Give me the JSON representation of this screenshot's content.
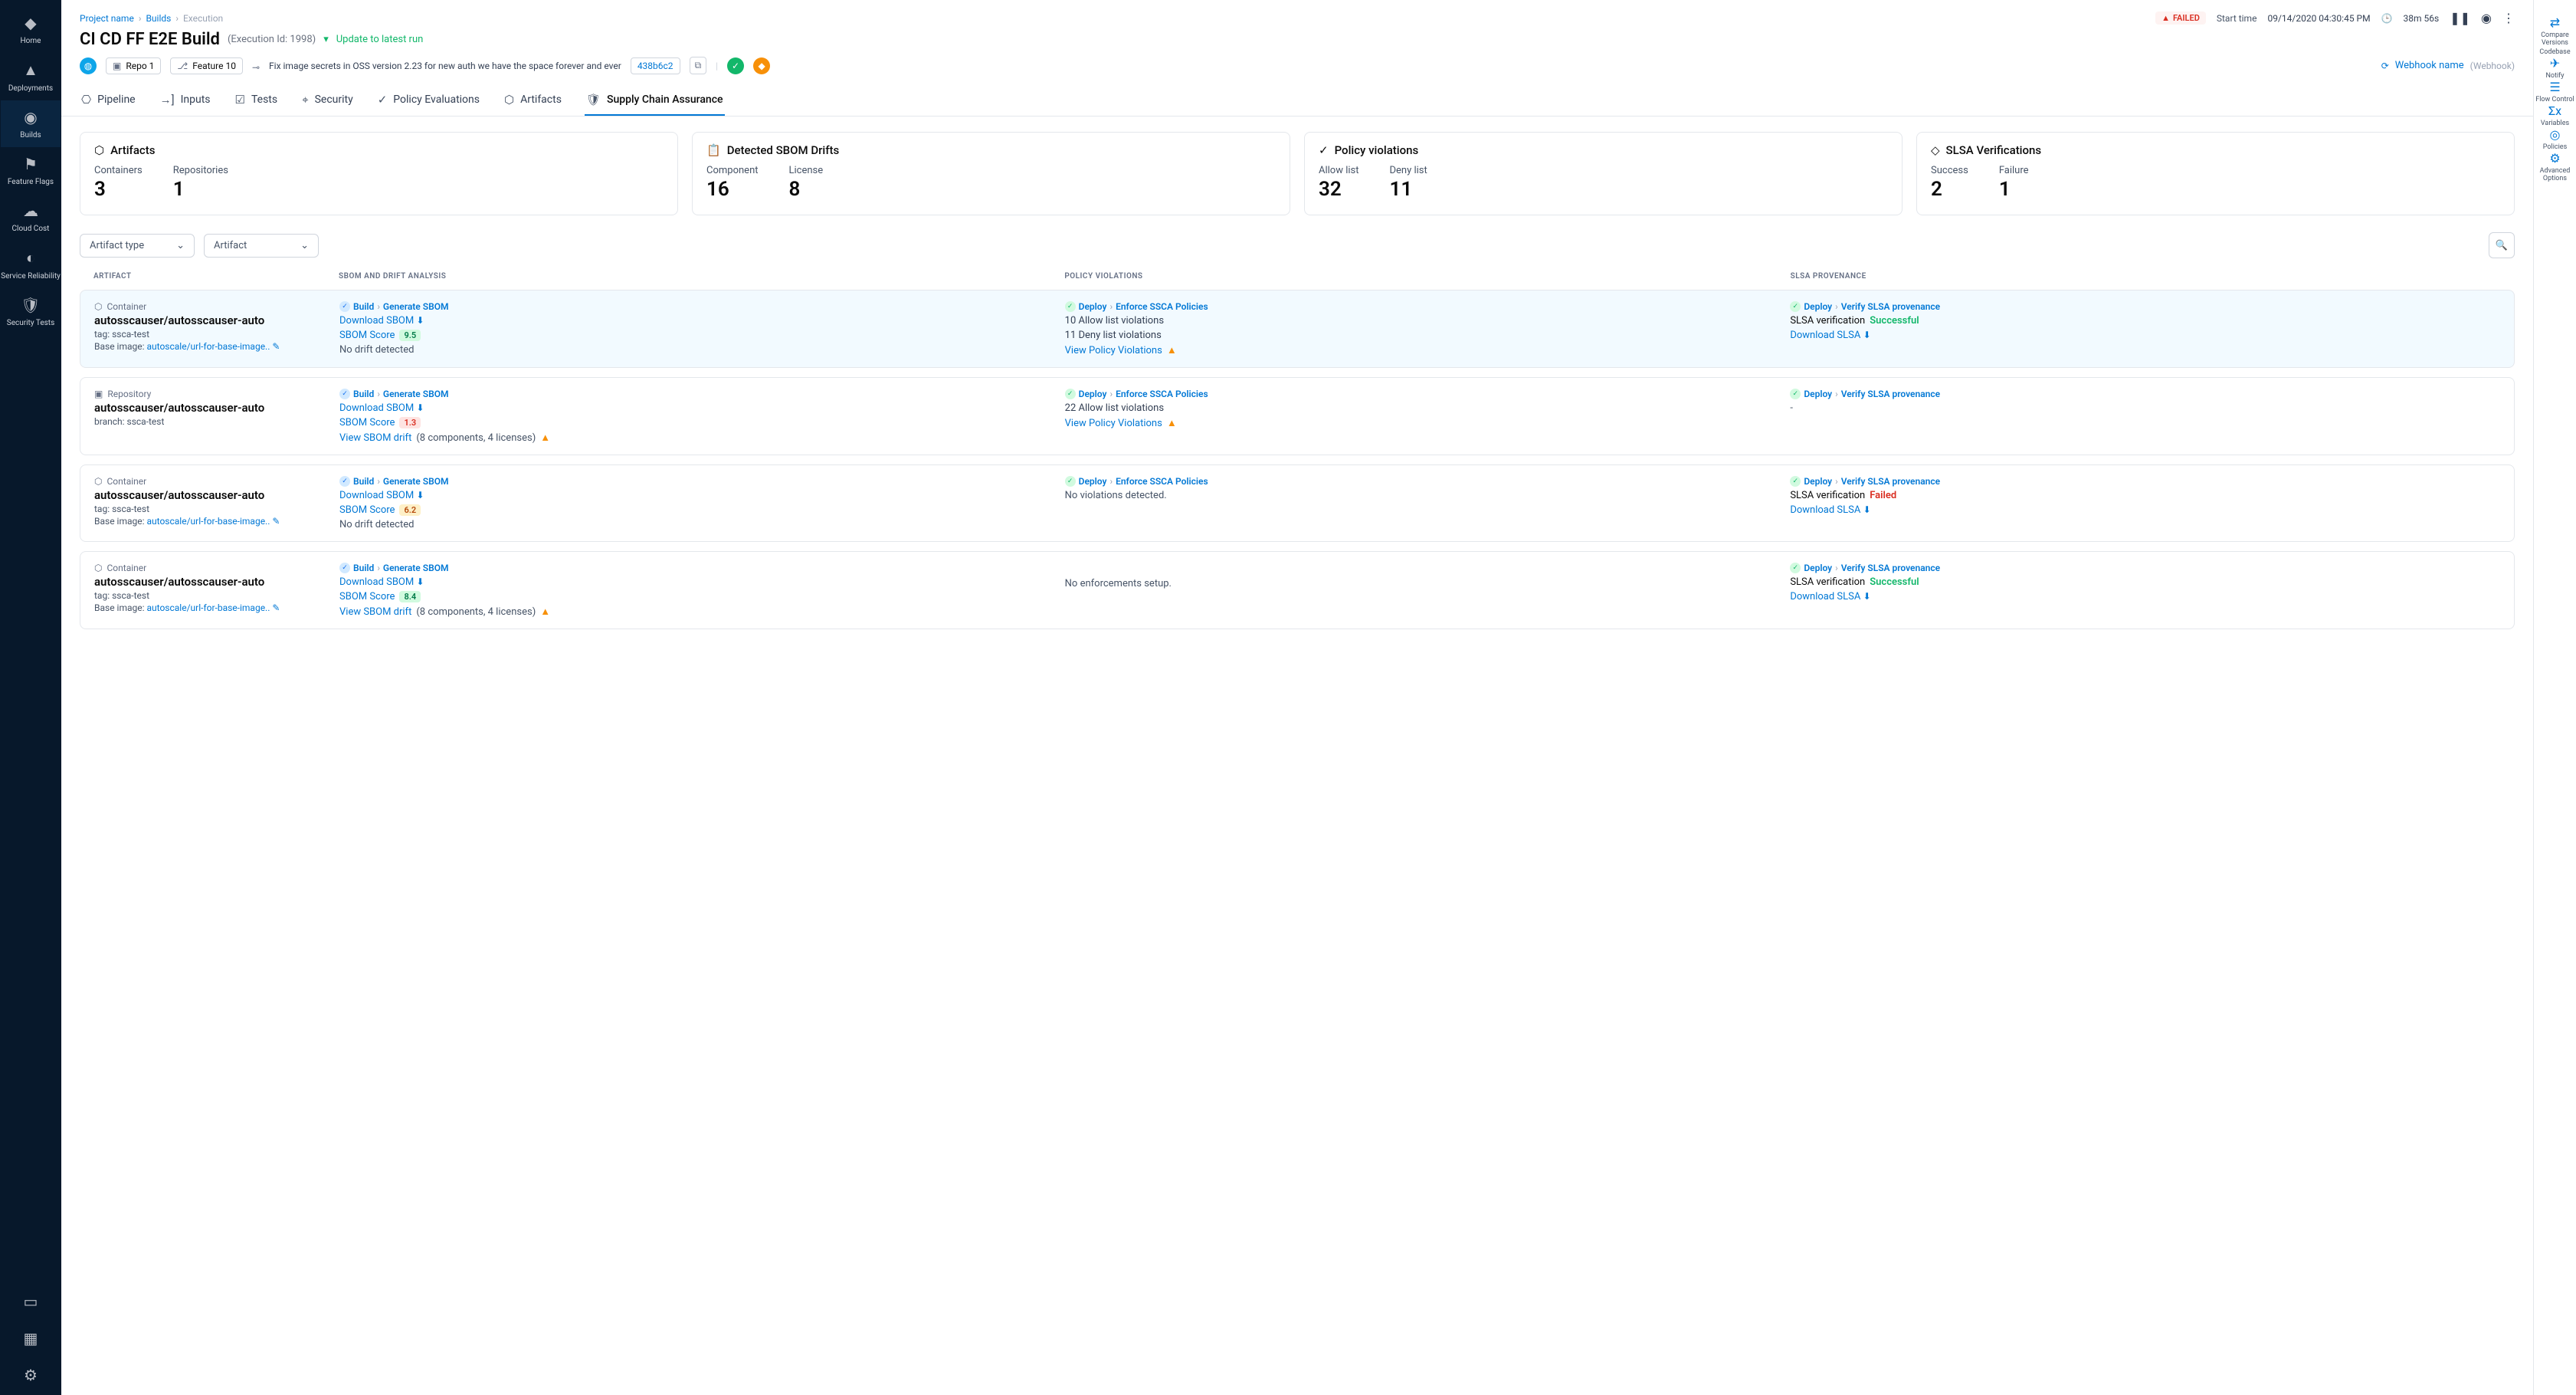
{
  "nav": {
    "items": [
      {
        "label": "Home",
        "icon": "◆"
      },
      {
        "label": "Deployments",
        "icon": "▲"
      },
      {
        "label": "Builds",
        "icon": "◉"
      },
      {
        "label": "Feature Flags",
        "icon": "⚑"
      },
      {
        "label": "Cloud Cost",
        "icon": "☁"
      },
      {
        "label": "Service Reliability",
        "icon": "◐"
      },
      {
        "label": "Security Tests",
        "icon": "🛡"
      }
    ],
    "active": 2
  },
  "rail": [
    {
      "label": "Compare Versions",
      "icon": "⇄"
    },
    {
      "label": "Codebase",
      "icon": "</>"
    },
    {
      "label": "Notify",
      "icon": "✈"
    },
    {
      "label": "Flow Control",
      "icon": "☰"
    },
    {
      "label": "Variables",
      "icon": "Σx"
    },
    {
      "label": "Policies",
      "icon": "◎"
    },
    {
      "label": "Advanced Options",
      "icon": "⚙"
    }
  ],
  "breadcrumb": {
    "project": "Project name",
    "builds": "Builds",
    "page": "Execution"
  },
  "header": {
    "title": "CI CD FF E2E Build",
    "exec_id": "(Execution Id: 1998)",
    "update": "Update to latest run",
    "status": "FAILED",
    "start_label": "Start time",
    "start_time": "09/14/2020 04:30:45 PM",
    "duration": "38m 56s"
  },
  "meta": {
    "repo": "Repo 1",
    "feature": "Feature 10",
    "commit_msg": "Fix image secrets in OSS version 2.23 for new auth we have the space forever and ever",
    "commit_hash": "438b6c2",
    "webhook_name": "Webhook name",
    "webhook_label": "(Webhook)"
  },
  "tabs": [
    {
      "label": "Pipeline",
      "icon": "⎔"
    },
    {
      "label": "Inputs",
      "icon": "→]"
    },
    {
      "label": "Tests",
      "icon": "☑"
    },
    {
      "label": "Security",
      "icon": "⌖"
    },
    {
      "label": "Policy Evaluations",
      "icon": "✓"
    },
    {
      "label": "Artifacts",
      "icon": "⬡"
    },
    {
      "label": "Supply Chain Assurance",
      "icon": "🛡"
    }
  ],
  "active_tab": 6,
  "cards": [
    {
      "title": "Artifacts",
      "icon": "⬡",
      "stats": [
        {
          "label": "Containers",
          "val": "3"
        },
        {
          "label": "Repositories",
          "val": "1"
        }
      ]
    },
    {
      "title": "Detected SBOM Drifts",
      "icon": "📋",
      "stats": [
        {
          "label": "Component",
          "val": "16"
        },
        {
          "label": "License",
          "val": "8"
        }
      ]
    },
    {
      "title": "Policy violations",
      "icon": "✓",
      "stats": [
        {
          "label": "Allow list",
          "val": "32"
        },
        {
          "label": "Deny list",
          "val": "11"
        }
      ]
    },
    {
      "title": "SLSA Verifications",
      "icon": "◇",
      "stats": [
        {
          "label": "Success",
          "val": "2"
        },
        {
          "label": "Failure",
          "val": "1"
        }
      ]
    }
  ],
  "filters": {
    "artifact_type": "Artifact type",
    "artifact": "Artifact"
  },
  "columns": [
    "ARTIFACT",
    "SBOM AND  DRIFT ANALYSIS",
    "POLICY VIOLATIONS",
    "SLSA PROVENANCE"
  ],
  "steps": {
    "build": "Build",
    "generate": "Generate SBOM",
    "deploy": "Deploy",
    "enforce": "Enforce SSCA Policies",
    "verify": "Verify SLSA provenance"
  },
  "labels": {
    "download_sbom": "Download SBOM",
    "sbom_score": "SBOM Score",
    "no_drift": "No drift detected",
    "view_drift": "View SBOM drift",
    "view_violations": "View Policy Violations",
    "no_violations": "No violations detected.",
    "no_enforce": "No enforcements setup.",
    "slsa_verif": "SLSA verification",
    "download_slsa": "Download SLSA",
    "successful": "Successful",
    "failed": "Failed",
    "tag": "tag:",
    "branch": "branch:",
    "base_image": "Base image:"
  },
  "rows": [
    {
      "highlight": true,
      "type": "Container",
      "name": "autosscauser/autosscauser-auto",
      "tag": "ssca-test",
      "base_image": "autoscale/url-for-base-image..",
      "score": "9.5",
      "score_class": "score-green",
      "drift": null,
      "allow": "10 Allow list violations",
      "deny": "11 Deny list violations",
      "show_violations_link": true,
      "slsa": "Successful",
      "slsa_class": "status-green",
      "slsa_download": true
    },
    {
      "highlight": false,
      "type": "Repository",
      "name": "autosscauser/autosscauser-auto",
      "branch": "ssca-test",
      "score": "1.3",
      "score_class": "score-red",
      "drift": "(8 components, 4 licenses)",
      "allow": "22 Allow list violations",
      "show_violations_link": true,
      "slsa": "-"
    },
    {
      "highlight": false,
      "type": "Container",
      "name": "autosscauser/autosscauser-auto",
      "tag": "ssca-test",
      "base_image": "autoscale/url-for-base-image..",
      "score": "6.2",
      "score_class": "score-orange",
      "drift": null,
      "no_violations": true,
      "slsa": "Failed",
      "slsa_class": "status-red",
      "slsa_download": true
    },
    {
      "highlight": false,
      "type": "Container",
      "name": "autosscauser/autosscauser-auto",
      "tag": "ssca-test",
      "base_image": "autoscale/url-for-base-image..",
      "score": "8.4",
      "score_class": "score-green",
      "drift": "(8 components, 4 licenses)",
      "no_enforce": true,
      "slsa": "Successful",
      "slsa_class": "status-green",
      "slsa_download": true
    }
  ]
}
